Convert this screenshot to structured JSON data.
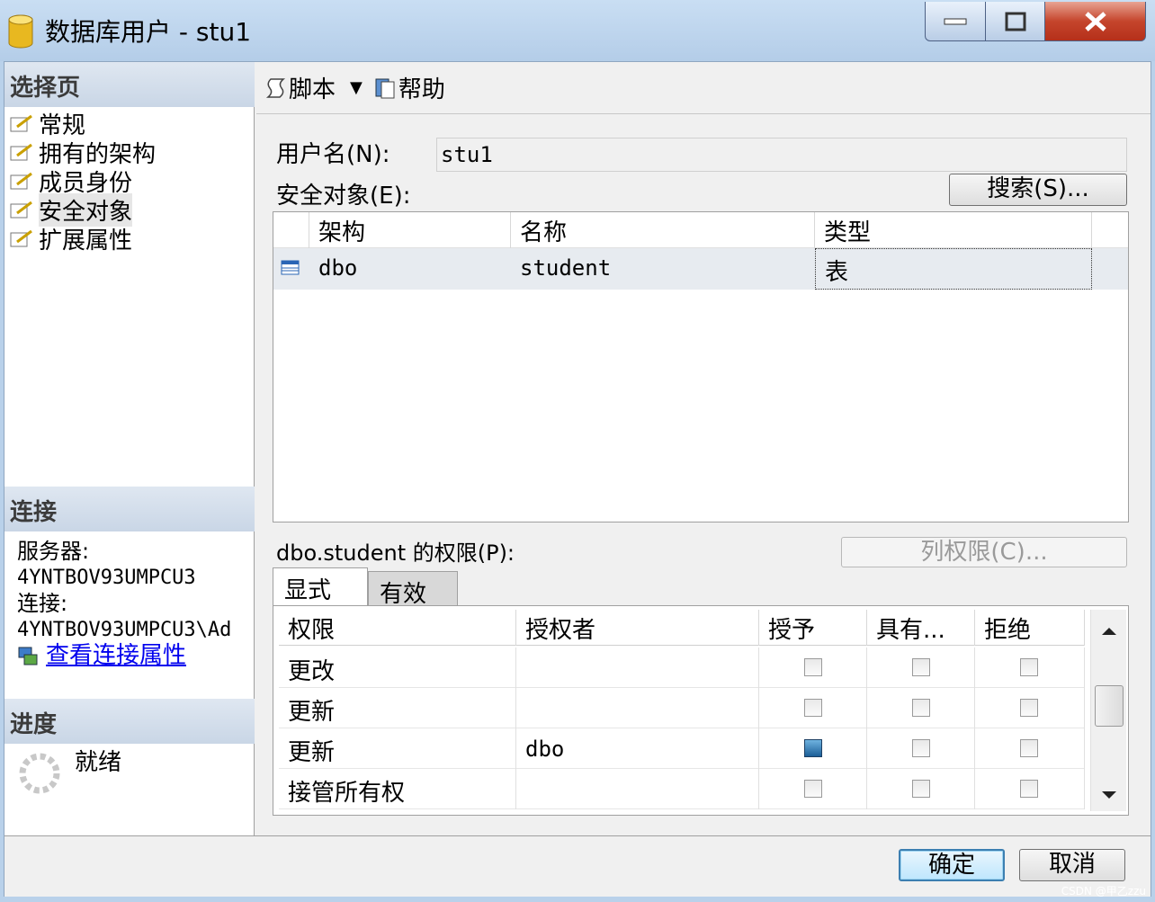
{
  "window": {
    "title": "数据库用户 - stu1"
  },
  "left": {
    "select_page_header": "选择页",
    "pages": [
      "常规",
      "拥有的架构",
      "成员身份",
      "安全对象",
      "扩展属性"
    ],
    "connection_header": "连接",
    "server_label": "服务器:",
    "server_value": "4YNTBOV93UMPCU3",
    "connection_label": "连接:",
    "connection_value": "4YNTBOV93UMPCU3\\Ad",
    "view_connection_properties": "查看连接属性",
    "progress_header": "进度",
    "progress_status": "就绪"
  },
  "toolbar": {
    "script_label": "脚本",
    "help_label": "帮助"
  },
  "form": {
    "username_label": "用户名(N):",
    "username_value": "stu1",
    "securables_label": "安全对象(E):",
    "search_button": "搜索(S)..."
  },
  "securables": {
    "columns": [
      "架构",
      "名称",
      "类型"
    ],
    "rows": [
      {
        "schema": "dbo",
        "name": "student",
        "type": "表"
      }
    ]
  },
  "permissions": {
    "label": "dbo.student 的权限(P):",
    "column_permissions_button": "列权限(C)...",
    "tabs": [
      "显式",
      "有效"
    ],
    "columns": [
      "权限",
      "授权者",
      "授予",
      "具有...",
      "拒绝"
    ],
    "rows": [
      {
        "permission": "更改",
        "grantor": "",
        "grant": false,
        "with_grant": false,
        "deny": false
      },
      {
        "permission": "更新",
        "grantor": "",
        "grant": false,
        "with_grant": false,
        "deny": false
      },
      {
        "permission": "更新",
        "grantor": "dbo",
        "grant": true,
        "with_grant": false,
        "deny": false
      },
      {
        "permission": "接管所有权",
        "grantor": "",
        "grant": false,
        "with_grant": false,
        "deny": false
      }
    ]
  },
  "buttons": {
    "ok": "确定",
    "cancel": "取消"
  },
  "watermark": "CSDN @甲乙zzu"
}
